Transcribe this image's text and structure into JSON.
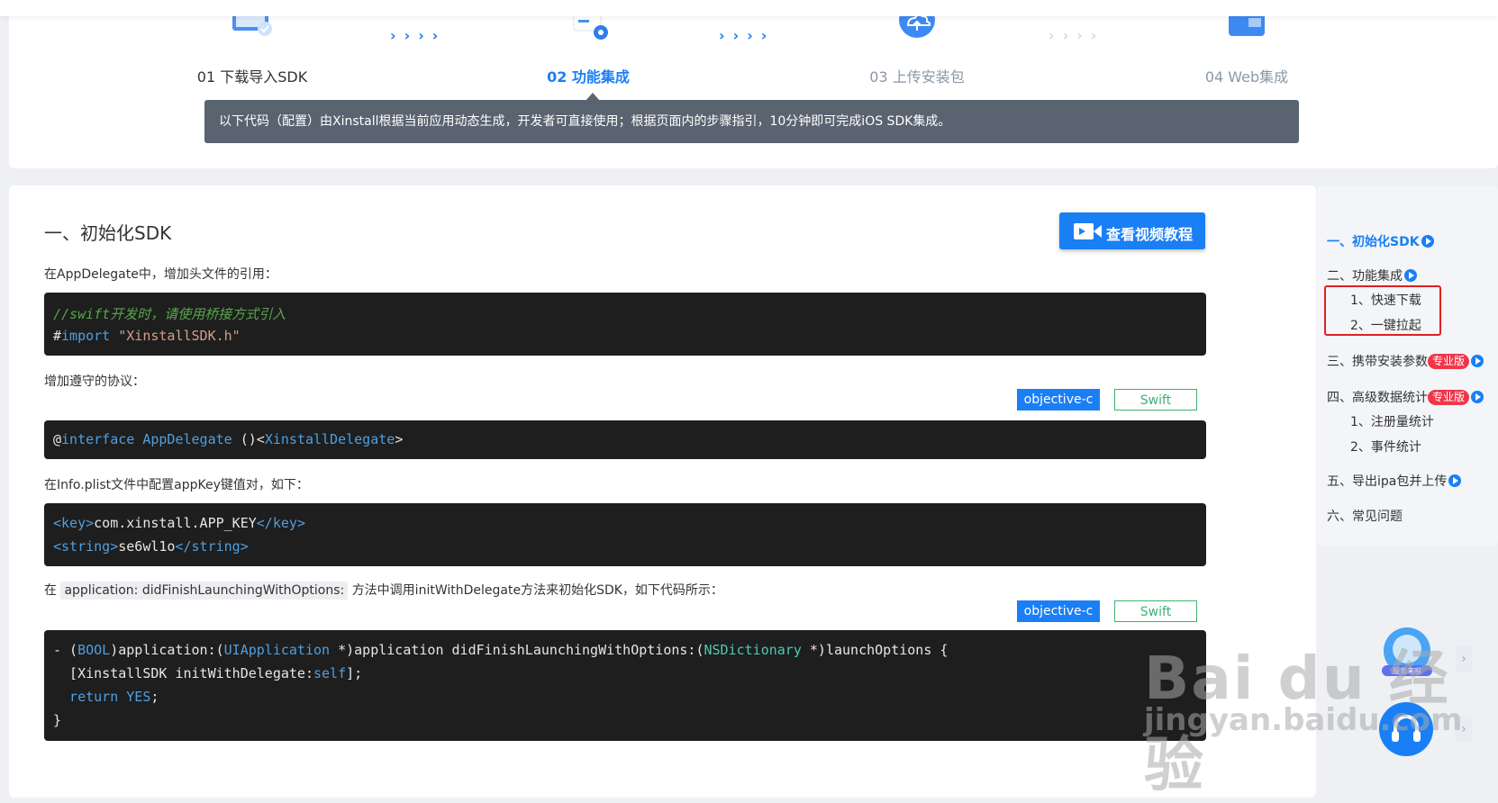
{
  "steps": [
    {
      "label": "01 下载导入SDK",
      "icon": "download-sdk-icon"
    },
    {
      "label": "02 功能集成",
      "icon": "integration-icon"
    },
    {
      "label": "03 上传安装包",
      "icon": "upload-cloud-icon"
    },
    {
      "label": "04 Web集成",
      "icon": "web-folder-icon"
    }
  ],
  "step_arrows": "››››",
  "notice": "以下代码（配置）由Xinstall根据当前应用动态生成，开发者可直接使用；根据页面内的步骤指引，10分钟即可完成iOS SDK集成。",
  "section": {
    "title": "一、初始化SDK",
    "video_button": "查看视频教程"
  },
  "paragraphs": {
    "p1": "在AppDelegate中，增加头文件的引用：",
    "p2": "增加遵守的协议：",
    "p3": "在Info.plist文件中配置appKey键值对，如下：",
    "p4_prefix": "在",
    "p4_code": "application: didFinishLaunchingWithOptions:",
    "p4_suffix": "方法中调用initWithDelegate方法来初始化SDK，如下代码所示："
  },
  "lang_tabs": {
    "objc": "objective-c",
    "swift": "Swift"
  },
  "code": {
    "b1_comment": "//swift开发时，请使用桥接方式引入",
    "b1_hash": "#",
    "b1_import": "import",
    "b1_file": "\"XinstallSDK.h\"",
    "b2_at": "@",
    "b2_interface": "interface AppDelegate",
    "b2_paren": " ()<",
    "b2_delegate": "XinstallDelegate",
    "b2_end": ">",
    "b3_open1": "<",
    "b3_key": "key",
    "b3_close1": ">",
    "b3_keyval": "com.xinstall.APP_KEY",
    "b3_endkey_open": "</",
    "b3_endkey": "key",
    "b3_endkey_close": ">",
    "b3_open2": "<",
    "b3_string": "string",
    "b3_close2": ">",
    "b3_strval": "se6wl1o",
    "b3_endstr_open": "</",
    "b3_endstr": "string",
    "b3_endstr_close": ">",
    "b4_l1_a": "- (",
    "b4_l1_bool": "BOOL",
    "b4_l1_b": ")application:(",
    "b4_l1_uiapp": "UIApplication",
    "b4_l1_c": " *)application didFinishLaunchingWithOptions:(",
    "b4_l1_nsdict": "NSDictionary",
    "b4_l1_d": " *)launchOptions {",
    "b4_l2_a": "  [XinstallSDK initWithDelegate:",
    "b4_l2_self": "self",
    "b4_l2_b": "];",
    "b4_l3_return": "  return",
    "b4_l3_yes": " YES",
    "b4_l3_semi": ";",
    "b4_l4": "}"
  },
  "toc": {
    "i1": "一、初始化SDK",
    "i2": "二、功能集成",
    "i2_s1": "1、快速下载",
    "i2_s2": "2、一键拉起",
    "i3": "三、携带安装参数",
    "i4": "四、高级数据统计",
    "i4_s1": "1、注册量统计",
    "i4_s2": "2、事件统计",
    "i5": "五、导出ipa包并上传",
    "i6": "六、常见问题",
    "pro_badge": "专业版"
  },
  "floating": {
    "badge_text": "服务来啦"
  },
  "watermark": {
    "big": "Bai du 经验",
    "small": "jingyan.baidu.com"
  },
  "colors": {
    "accent": "#1a7ff5",
    "code_bg": "#1e1e1e",
    "notice_bg": "#5a6370",
    "pro_badge": "#f0364a",
    "highlight_box": "#e02020"
  }
}
